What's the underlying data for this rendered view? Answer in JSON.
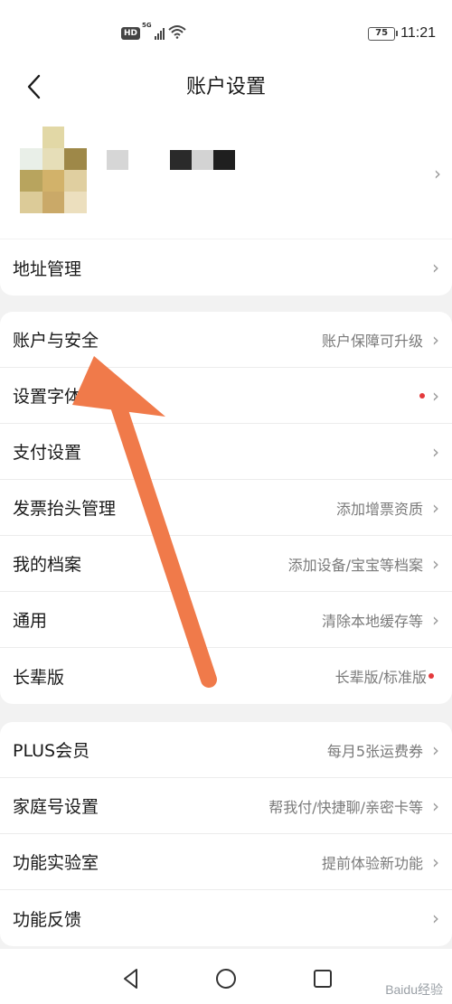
{
  "status_bar": {
    "hd": "HD",
    "net": "5G",
    "battery": "75",
    "time": "11:21"
  },
  "header": {
    "title": "账户设置",
    "back_icon": "chevron-left-icon"
  },
  "profile": {
    "chevron": "›"
  },
  "groups": [
    {
      "items": [
        {
          "label": "地址管理",
          "hint": "",
          "dot": false
        }
      ]
    },
    {
      "items": [
        {
          "label": "账户与安全",
          "hint": "账户保障可升级",
          "dot": false
        },
        {
          "label": "设置字体大小",
          "hint": "",
          "dot": true
        },
        {
          "label": "支付设置",
          "hint": "",
          "dot": false
        },
        {
          "label": "发票抬头管理",
          "hint": "添加增票资质",
          "dot": false
        },
        {
          "label": "我的档案",
          "hint": "添加设备/宝宝等档案",
          "dot": false
        },
        {
          "label": "通用",
          "hint": "清除本地缓存等",
          "dot": false
        },
        {
          "label": "长辈版",
          "hint": "长辈版/标准版",
          "dot": true
        }
      ]
    },
    {
      "items": [
        {
          "label": "PLUS会员",
          "hint": "每月5张运费券",
          "dot": false
        },
        {
          "label": "家庭号设置",
          "hint": "帮我付/快捷聊/亲密卡等",
          "dot": false
        },
        {
          "label": "功能实验室",
          "hint": "提前体验新功能",
          "dot": false
        },
        {
          "label": "功能反馈",
          "hint": "",
          "dot": false
        }
      ]
    }
  ],
  "chevron_glyph": "›",
  "watermark": "Baidu经验",
  "colors": {
    "accent_dot": "#e4393c",
    "annotation_arrow": "#f07a4a"
  }
}
